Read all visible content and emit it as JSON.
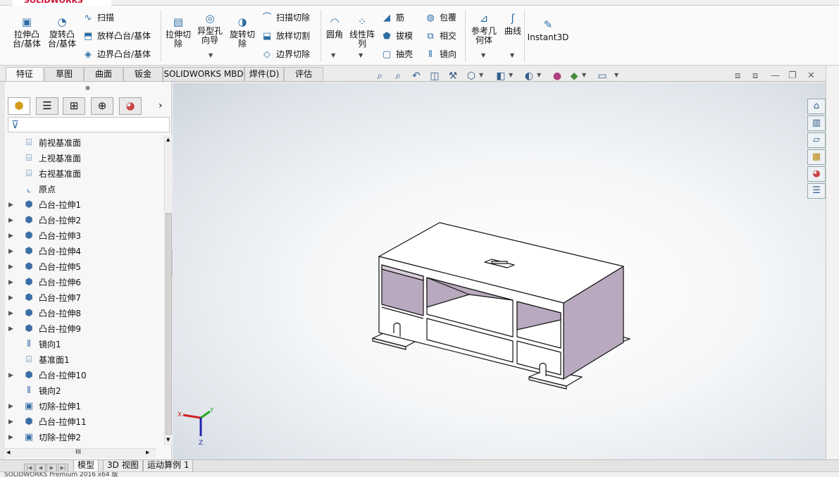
{
  "app": {
    "logo": "SOLIDWORKS"
  },
  "ribbon": {
    "extrude_boss": "拉伸凸\n台/基体",
    "revolve_boss": "旋转凸\n台/基体",
    "sweep": "扫描",
    "loft_boss": "放样凸台/基体",
    "boundary_boss": "边界凸台/基体",
    "extrude_cut": "拉伸切\n除",
    "hole_wizard": "异型孔\n向导",
    "revolve_cut": "旋转切\n除",
    "swept_cut": "扫描切除",
    "lofted_cut": "放样切割",
    "boundary_cut": "边界切除",
    "fillet": "圆角",
    "linear_pattern": "线性阵\n列",
    "rib": "筋",
    "draft": "拔模",
    "shell": "抽壳",
    "wrap": "包覆",
    "intersect": "相交",
    "mirror": "镜向",
    "ref_geometry": "参考几\n何体",
    "curves": "曲线",
    "instant3d": "Instant3D"
  },
  "tabs": [
    {
      "label": "特征",
      "active": true
    },
    {
      "label": "草图"
    },
    {
      "label": "曲面"
    },
    {
      "label": "钣金"
    },
    {
      "label": "SOLIDWORKS MBD"
    },
    {
      "label": "焊件(D)"
    },
    {
      "label": "评估"
    }
  ],
  "tree": [
    {
      "label": "前视基准面",
      "icon": "plane-icon",
      "expandable": false
    },
    {
      "label": "上视基准面",
      "icon": "plane-icon",
      "expandable": false
    },
    {
      "label": "右视基准面",
      "icon": "plane-icon",
      "expandable": false
    },
    {
      "label": "原点",
      "icon": "origin-icon",
      "expandable": false
    },
    {
      "label": "凸台-拉伸1",
      "icon": "extrude-icon",
      "expandable": true
    },
    {
      "label": "凸台-拉伸2",
      "icon": "extrude-icon",
      "expandable": true
    },
    {
      "label": "凸台-拉伸3",
      "icon": "extrude-icon",
      "expandable": true
    },
    {
      "label": "凸台-拉伸4",
      "icon": "extrude-icon",
      "expandable": true
    },
    {
      "label": "凸台-拉伸5",
      "icon": "extrude-icon",
      "expandable": true
    },
    {
      "label": "凸台-拉伸6",
      "icon": "extrude-icon",
      "expandable": true
    },
    {
      "label": "凸台-拉伸7",
      "icon": "extrude-icon",
      "expandable": true
    },
    {
      "label": "凸台-拉伸8",
      "icon": "extrude-icon",
      "expandable": true
    },
    {
      "label": "凸台-拉伸9",
      "icon": "extrude-icon",
      "expandable": true
    },
    {
      "label": "镜向1",
      "icon": "mirror-icon",
      "expandable": false
    },
    {
      "label": "基准面1",
      "icon": "plane-icon",
      "expandable": false
    },
    {
      "label": "凸台-拉伸10",
      "icon": "extrude-icon",
      "expandable": true
    },
    {
      "label": "镜向2",
      "icon": "mirror-icon",
      "expandable": false
    },
    {
      "label": "切除-拉伸1",
      "icon": "cut-icon",
      "expandable": true
    },
    {
      "label": "凸台-拉伸11",
      "icon": "extrude-icon",
      "expandable": true
    },
    {
      "label": "切除-拉伸2",
      "icon": "cut-icon",
      "expandable": true
    }
  ],
  "hscroll_label": "III",
  "bottom_tabs": [
    {
      "label": "模型",
      "active": true
    },
    {
      "label": "3D 视图"
    },
    {
      "label": "运动算例 1"
    }
  ],
  "status": "SOLIDWORKS Premium 2016 x64 版",
  "triad": {
    "x": "X",
    "y": "Y",
    "z": "Z"
  },
  "colors": {
    "accent": "#2e6da4",
    "model_face": "#ffffff",
    "model_inner": "#b9a9be",
    "model_edge": "#111111"
  }
}
